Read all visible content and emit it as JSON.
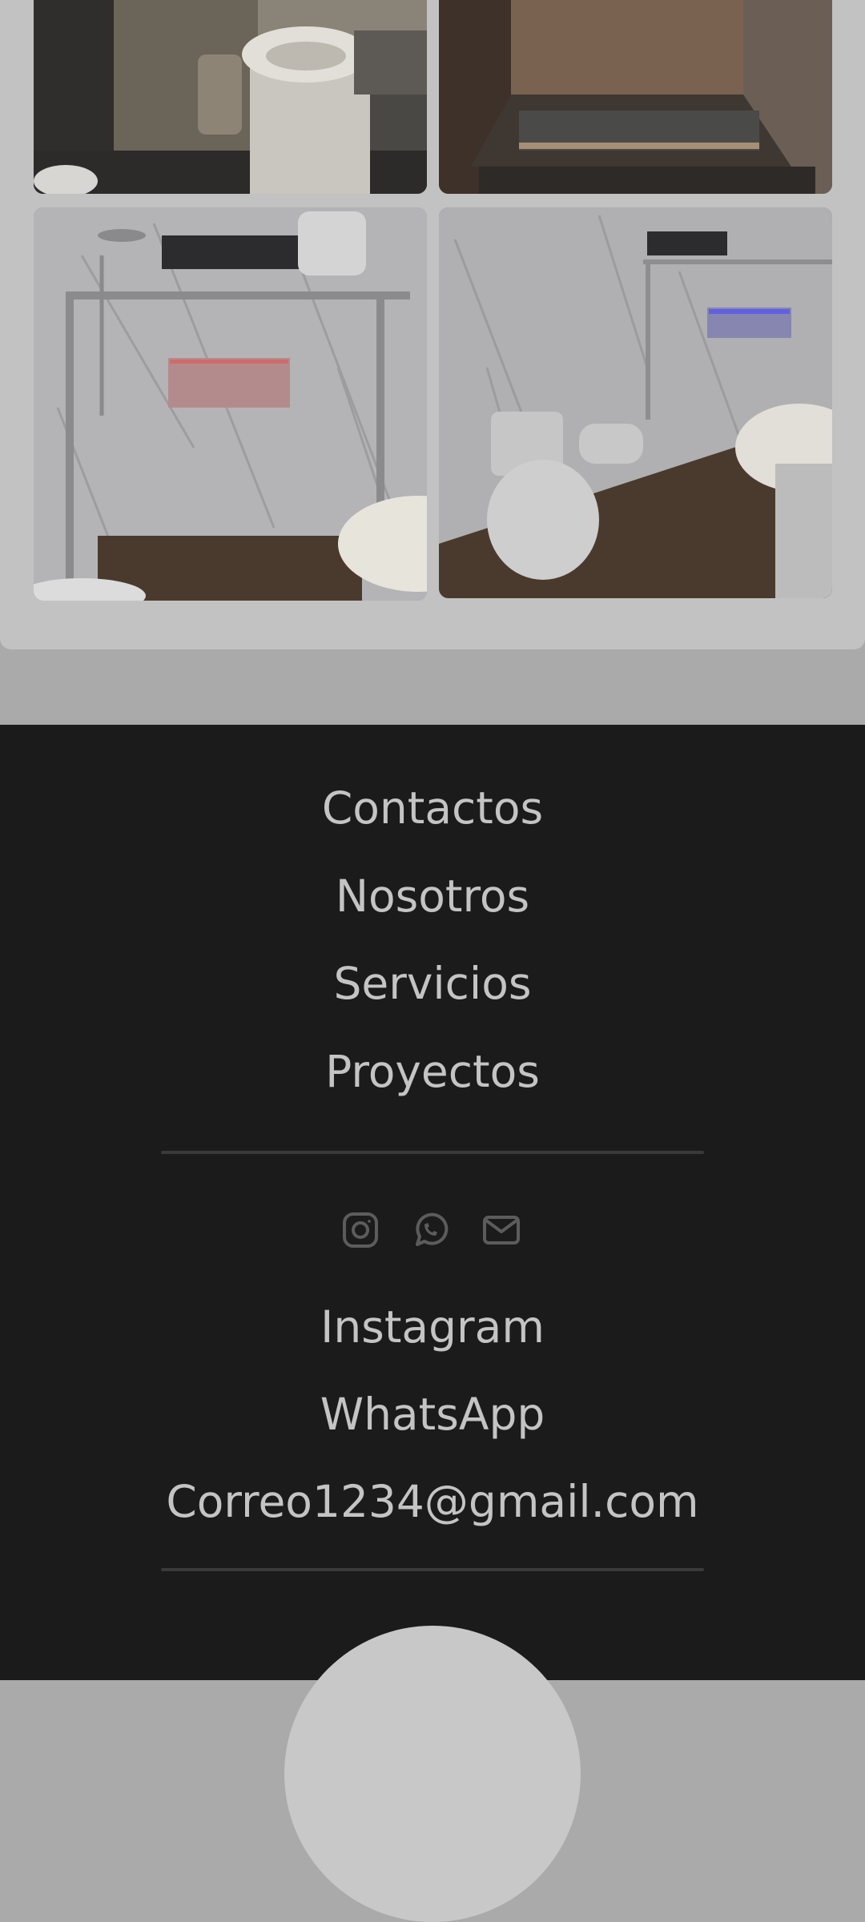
{
  "gallery": {
    "photos": [
      {
        "name": "bathroom-vanity-before"
      },
      {
        "name": "bathroom-gutted-before"
      },
      {
        "name": "bathroom-shower-after"
      },
      {
        "name": "bathroom-toilet-after"
      }
    ]
  },
  "footer": {
    "nav": {
      "contactos": "Contactos",
      "nosotros": "Nosotros",
      "servicios": "Servicios",
      "proyectos": "Proyectos"
    },
    "social_icons": [
      "instagram-icon",
      "whatsapp-icon",
      "mail-icon"
    ],
    "links": {
      "instagram": "Instagram",
      "whatsapp": "WhatsApp",
      "email": "Correo1234@gmail.com"
    }
  },
  "colors": {
    "footer_bg": "#1b1b1c",
    "footer_text": "#c4c4c4",
    "icon_color": "#5c5c5c",
    "card_bg": "#c2c2c2"
  }
}
